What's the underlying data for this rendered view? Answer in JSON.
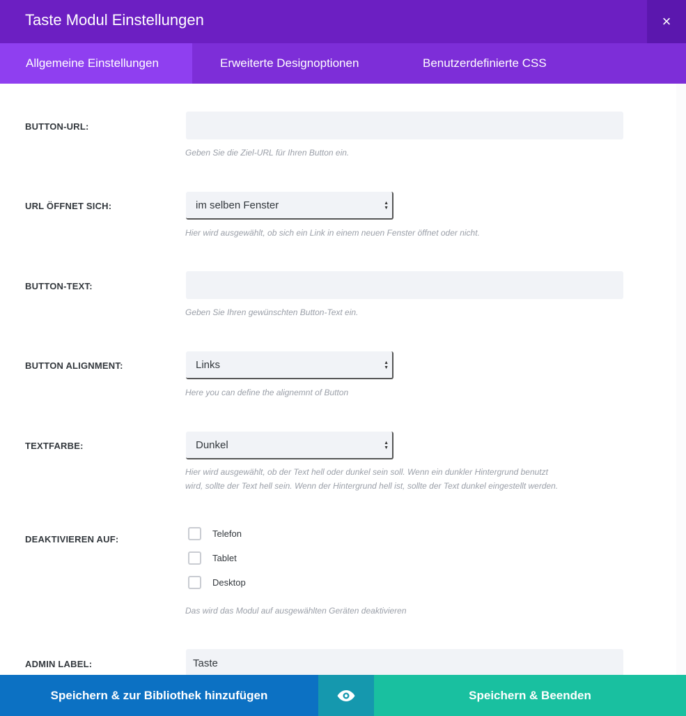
{
  "header": {
    "title": "Taste Modul Einstellungen",
    "close_glyph": "×"
  },
  "tabs": [
    {
      "label": "Allgemeine Einstellungen",
      "active": true
    },
    {
      "label": "Erweiterte Designoptionen",
      "active": false
    },
    {
      "label": "Benutzerdefinierte CSS",
      "active": false
    }
  ],
  "fields": {
    "button_url": {
      "label": "BUTTON-URL:",
      "value": "",
      "hint": "Geben Sie die Ziel-URL für Ihren Button ein."
    },
    "url_opens": {
      "label": "URL ÖFFNET SICH:",
      "value": "im selben Fenster",
      "hint": "Hier wird ausgewählt, ob sich ein Link in einem neuen Fenster öffnet oder nicht."
    },
    "button_text": {
      "label": "BUTTON-TEXT:",
      "value": "",
      "hint": "Geben Sie Ihren gewünschten Button-Text ein."
    },
    "button_alignment": {
      "label": "BUTTON ALIGNMENT:",
      "value": "Links",
      "hint": "Here you can define the alignemnt of Button"
    },
    "text_color": {
      "label": "TEXTFARBE:",
      "value": "Dunkel",
      "hint_line1": "Hier wird ausgewählt, ob der Text hell oder dunkel sein soll. Wenn ein dunkler Hintergrund benutzt",
      "hint_line2": "wird, sollte der Text hell sein. Wenn der Hintergrund hell ist, sollte der Text dunkel eingestellt werden."
    },
    "disable_on": {
      "label": "DEAKTIVIEREN AUF:",
      "options": [
        {
          "label": "Telefon",
          "checked": false
        },
        {
          "label": "Tablet",
          "checked": false
        },
        {
          "label": "Desktop",
          "checked": false
        }
      ],
      "hint": "Das wird das Modul auf ausgewählten Geräten deaktivieren"
    },
    "admin_label": {
      "label": "ADMIN LABEL:",
      "value": "Taste"
    }
  },
  "footer": {
    "library_label": "Speichern & zur Bibliothek hinzufügen",
    "preview_icon": "eye-icon",
    "save_label": "Speichern & Beenden"
  },
  "colors": {
    "header": "#6c1fc2",
    "tabs": "#7d2ed8",
    "active_tab": "#8f3ff0",
    "library_button": "#0c71c3",
    "preview_button": "#1598ae",
    "save_button": "#19c0a0"
  }
}
